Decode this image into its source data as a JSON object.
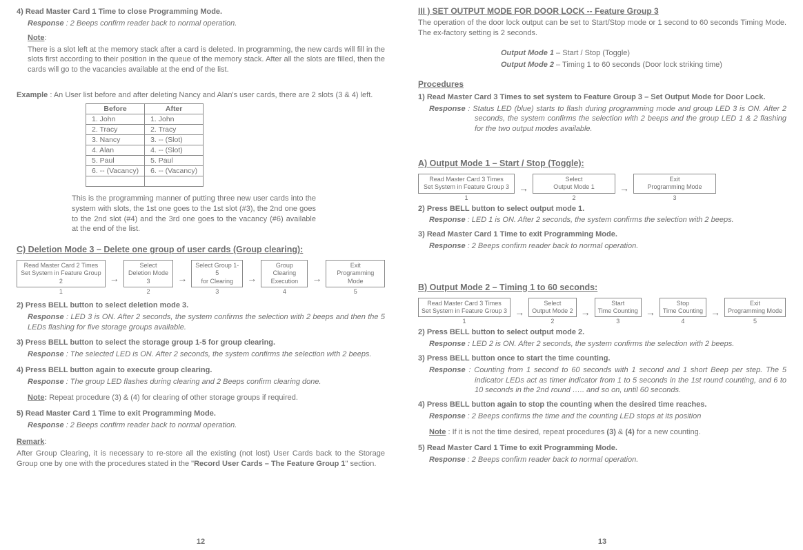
{
  "left": {
    "s4_title": "4) Read Master Card 1 Time to close Programming Mode.",
    "s4_resp_label": "Response",
    "s4_resp": ": 2 Beeps confirm reader back to normal operation.",
    "note_label": "Note",
    "note_text": "There is a slot left at the memory stack after a card is deleted. In programming, the new cards will fill in the slots first according to their position in the queue of the memory stack. After all the slots are filled, then the cards will go to the vacancies available at the end of the list.",
    "example_label": "Example",
    "example_text": ":  An User list before and after deleting Nancy and Alan's user cards, there are 2 slots (3 & 4) left.",
    "table": {
      "h1": "Before",
      "h2": "After",
      "rows": [
        [
          "1. John",
          "1. John"
        ],
        [
          "2. Tracy",
          "2. Tracy"
        ],
        [
          "3. Nancy",
          "3.    --    (Slot)"
        ],
        [
          "4. Alan",
          "4.    --    (Slot)"
        ],
        [
          "5. Paul",
          "5. Paul"
        ],
        [
          "6.    --    (Vacancy)",
          "6.    --    (Vacancy)"
        ],
        [
          "",
          ""
        ]
      ]
    },
    "after_table": "This is the programming manner of putting three new user cards into the system with slots, the 1st one goes to the 1st slot (#3), the 2nd one goes to the 2nd slot (#4) and the 3rd one goes to the vacancy (#6) available at the end of the list.",
    "c_head": "C) Deletion Mode 3 – Delete one group of user cards (Group clearing):",
    "c_flow": [
      {
        "l1": "Read Master Card 2 Times",
        "l2": "Set System in Feature Group 2",
        "n": "1"
      },
      {
        "l1": "Select",
        "l2": "Deletion Mode 3",
        "n": "2"
      },
      {
        "l1": "Select Group 1-5",
        "l2": "for Clearing",
        "n": "3"
      },
      {
        "l1": "Group Clearing",
        "l2": "Execution",
        "n": "4"
      },
      {
        "l1": "Exit",
        "l2": "Programming Mode",
        "n": "5"
      }
    ],
    "c2_title": "2) Press BELL button to select deletion mode 3.",
    "c2_resp": ":  LED 3 is ON. After 2 seconds, the system confirms the selection with 2 beeps and then the 5 LEDs flashing for five storage groups available.",
    "c3_title": "3) Press BELL button to select the storage group 1-5 for group clearing.",
    "c3_resp": ": The selected LED is ON. After 2 seconds, the system confirms the selection with 2 beeps.",
    "c4_title": "4) Press BELL button again to execute group clearing.",
    "c4_resp": ": The group LED flashes during clearing and 2 Beeps confirm clearing done.",
    "c_note": " Repeat procedure (3) & (4) for clearing of other storage groups if required.",
    "c5_title": "5) Read Master Card 1 Time to exit Programming Mode.",
    "c5_resp": ": 2 Beeps confirm reader back to normal operation.",
    "remark_label": "Remark",
    "remark_text1": "After Group Clearing, it is necessary to re-store all the existing (not lost) User Cards back to the Storage Group one by one with the procedures stated in the \"",
    "remark_bold": "Record User Cards – The Feature Group 1",
    "remark_text2": "\" section.",
    "page": "12"
  },
  "right": {
    "iii_head": "III ) SET OUTPUT MODE FOR DOOR LOCK -- Feature Group 3",
    "iii_intro": "The operation of the door lock output can be set to Start/Stop mode or 1 second to 60 seconds Timing Mode. The ex-factory setting is 2 seconds.",
    "om1_label": "Output Mode 1",
    "om1_desc": " – Start / Stop (Toggle)",
    "om2_label": "Output Mode 2",
    "om2_desc": " – Timing 1 to 60 seconds (Door lock striking time)",
    "proc_head": "Procedures",
    "p1_title": "1) Read Master Card 3 Times to set system to Feature Group 3 – Set Output Mode for Door Lock.",
    "p1_resp": ": Status LED (blue) starts to flash during programming mode and group LED 3 is ON. After 2 seconds, the system confirms the selection with 2 beeps and the group LED 1 & 2 flashing for the two output modes available.",
    "a_head": "A) Output Mode 1 – Start / Stop (Toggle):",
    "a_flow": [
      {
        "l1": "Read Master Card 3 Times",
        "l2": "Set System in Feature Group 3",
        "n": "1"
      },
      {
        "l1": "Select",
        "l2": "Output Mode 1",
        "n": "2"
      },
      {
        "l1": "Exit",
        "l2": "Programming Mode",
        "n": "3"
      }
    ],
    "a2_title": "2) Press BELL button to select output mode 1.",
    "a2_resp": ":  LED 1 is ON. After 2 seconds, the system confirms the selection with 2 beeps.",
    "a3_title": "3) Read Master Card 1 Time to exit Programming Mode.",
    "a3_resp": ": 2 Beeps confirm reader back to normal operation.",
    "b_head": "B) Output Mode 2 – Timing 1 to 60 seconds:",
    "b_flow": [
      {
        "l1": "Read Master Card 3 Times",
        "l2": "Set System in Feature Group 3",
        "n": "1"
      },
      {
        "l1": "Select",
        "l2": "Output Mode 2",
        "n": "2"
      },
      {
        "l1": "Start",
        "l2": "Time Counting",
        "n": "3"
      },
      {
        "l1": "Stop",
        "l2": "Time Counting",
        "n": "4"
      },
      {
        "l1": "Exit",
        "l2": "Programming Mode",
        "n": "5"
      }
    ],
    "b2_title": "2) Press BELL button to select output mode 2.",
    "b2_resp": " LED 2 is ON. After 2 seconds, the system confirms the selection with 2 beeps.",
    "b3_title": "3) Press BELL button once to start the time counting.",
    "b3_resp": ": Counting from 1 second to 60 seconds with 1 second and 1 short Beep per step. The 5 indicator LEDs act as timer indicator from 1 to 5 seconds in the 1st round counting, and 6 to 10 seconds in the 2nd round ….. and so on, until 60 seconds.",
    "b4_title": "4) Press BELL button again to stop the counting when the desired time reaches.",
    "b4_resp": ": 2 Beeps confirms the time and the counting LED stops at its position",
    "b_note": ": If it is not the time desired, repeat procedures ",
    "b_note_34a": "(3)",
    "b_note_34b": "(4)",
    "b_note_tail": " for a new counting.",
    "b5_title": "5) Read Master Card 1 Time to exit Programming Mode.",
    "b5_resp": ": 2 Beeps confirm reader back to normal operation.",
    "page": "13"
  },
  "common": {
    "resp_word": "Response",
    "note_word": "Note",
    "amp": " & "
  }
}
